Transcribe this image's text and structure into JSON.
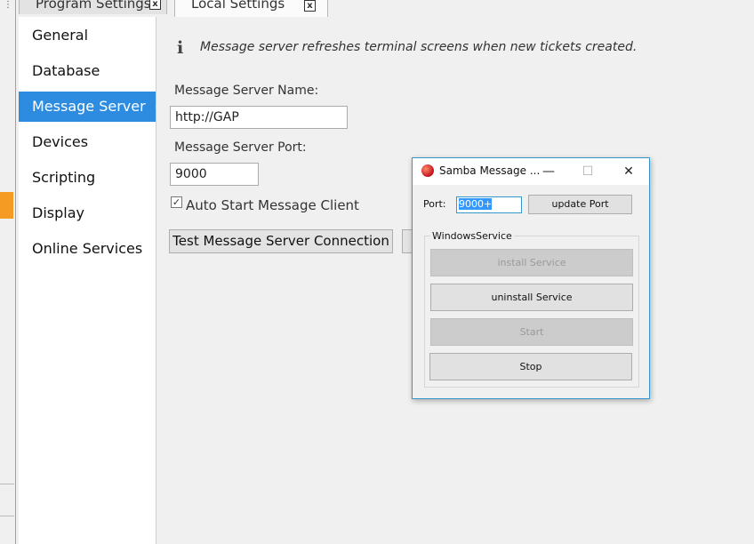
{
  "tabs": [
    {
      "label": "Program Settings",
      "close": "x"
    },
    {
      "label": "Local Settings",
      "close": "x"
    }
  ],
  "nav": {
    "items": [
      {
        "label": "General"
      },
      {
        "label": "Database"
      },
      {
        "label": "Message Server",
        "selected": true
      },
      {
        "label": "Devices"
      },
      {
        "label": "Scripting"
      },
      {
        "label": "Display"
      },
      {
        "label": "Online Services"
      }
    ]
  },
  "content": {
    "info_icon": "i",
    "info_text": "Message server refreshes terminal screens when new tickets created.",
    "name_label": "Message Server Name:",
    "name_value": "http://GAP",
    "port_label": "Message Server Port:",
    "port_value": "9000",
    "auto_start_label": "Auto Start Message Client",
    "auto_start_checked": true,
    "check_mark": "✓",
    "test_button": "Test Message Server Connection"
  },
  "dialog": {
    "title": "Samba Message ...",
    "minimize": "—",
    "maximize": "☐",
    "close": "✕",
    "port_label": "Port:",
    "port_value": "9000+",
    "update_button": "update Port",
    "group_label": "WindowsService",
    "install_button": "install Service",
    "uninstall_button": "uninstall Service",
    "start_button": "Start",
    "stop_button": "Stop"
  },
  "colors": {
    "selected_nav": "#2d8ce0",
    "dialog_border": "#3399cc",
    "accent_orange": "#f59a23"
  }
}
